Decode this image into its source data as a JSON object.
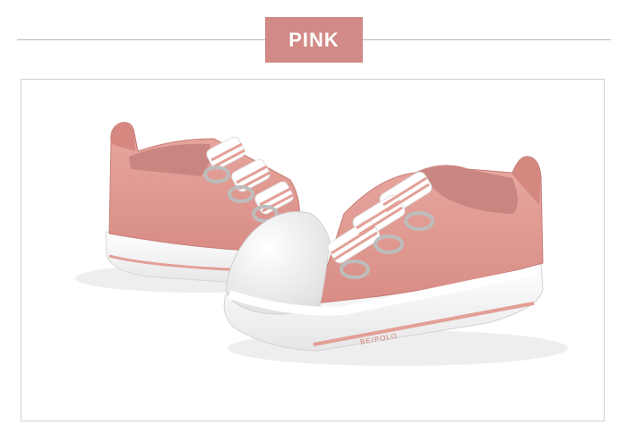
{
  "header": {
    "color_label": "PINK"
  },
  "product": {
    "brand_print": "BEIPOLO"
  },
  "colors": {
    "accent": "#d28a86",
    "shoe_canvas": "#e39f96",
    "shoe_stripe": "#f0a8a0",
    "sole": "#ffffff",
    "divider": "#b9b9b9"
  }
}
